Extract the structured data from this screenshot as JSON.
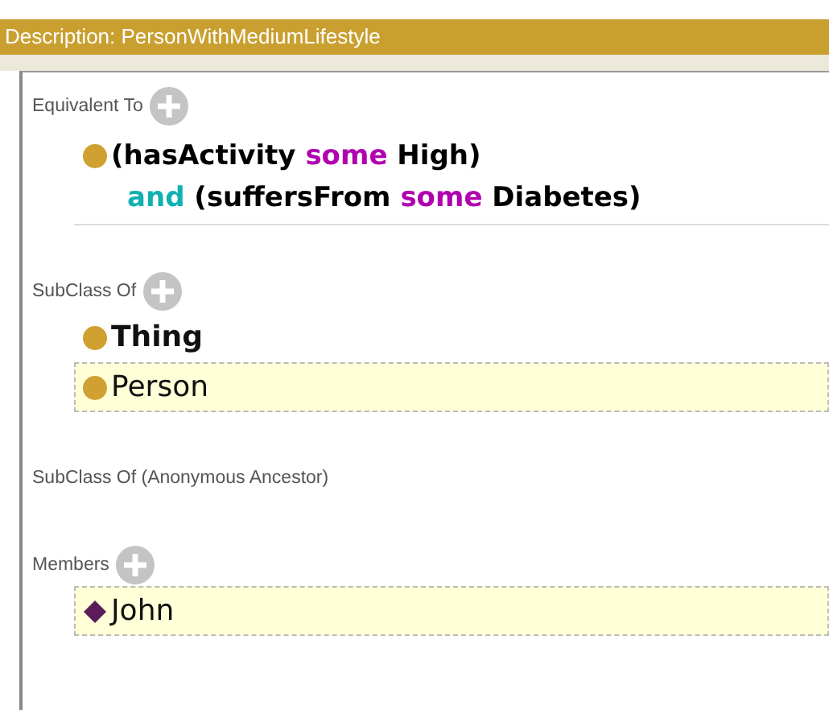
{
  "header": {
    "title": "Description: PersonWithMediumLifestyle"
  },
  "sections": [
    {
      "label": "Equivalent To",
      "addable": true,
      "items": [
        {
          "kind": "expression",
          "bold": true,
          "highlighted": false,
          "lines": [
            [
              {
                "text": "(hasActivity ",
                "kind": "plain"
              },
              {
                "text": "some",
                "kind": "quantifier"
              },
              {
                "text": " High)",
                "kind": "plain"
              }
            ],
            [
              {
                "text": "and",
                "kind": "connective"
              },
              {
                "text": " (suffersFrom ",
                "kind": "plain"
              },
              {
                "text": "some",
                "kind": "quantifier"
              },
              {
                "text": " Diabetes)",
                "kind": "plain"
              }
            ]
          ]
        }
      ]
    },
    {
      "label": "SubClass Of",
      "addable": true,
      "items": [
        {
          "kind": "class",
          "text": "Thing",
          "bold": true,
          "highlighted": false
        },
        {
          "kind": "class",
          "text": "Person",
          "bold": false,
          "highlighted": true
        }
      ]
    },
    {
      "label": "SubClass Of (Anonymous Ancestor)",
      "addable": false
    },
    {
      "label": "Members",
      "addable": true,
      "items": [
        {
          "kind": "individual",
          "text": "John",
          "bold": false,
          "highlighted": true
        }
      ]
    }
  ]
}
